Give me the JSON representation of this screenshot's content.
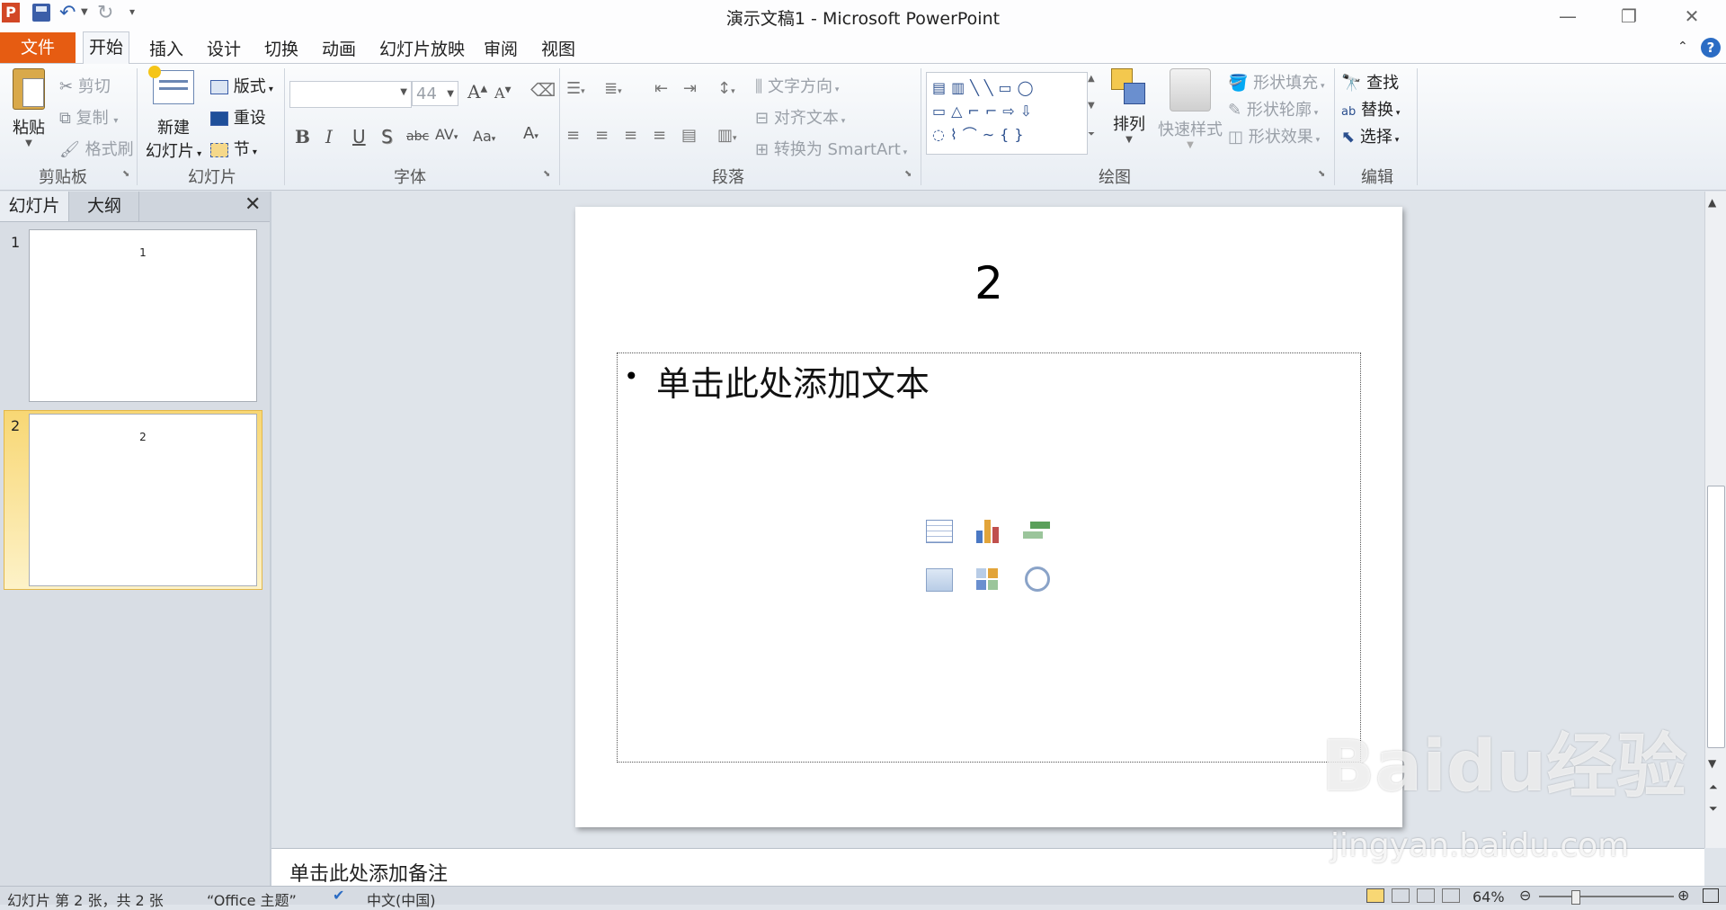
{
  "app": {
    "title": "演示文稿1 - Microsoft PowerPoint"
  },
  "quick_access": {
    "icons": [
      "powerpoint-logo-icon",
      "save-icon",
      "undo-icon",
      "redo-icon",
      "customize-icon"
    ]
  },
  "tabs": {
    "file": "文件",
    "items": [
      "开始",
      "插入",
      "设计",
      "切换",
      "动画",
      "幻灯片放映",
      "审阅",
      "视图"
    ],
    "active": "开始"
  },
  "ribbon": {
    "clipboard": {
      "paste": "粘贴",
      "cut": "剪切",
      "copy": "复制",
      "format_painter": "格式刷",
      "label": "剪贴板"
    },
    "slides": {
      "new_slide_1": "新建",
      "new_slide_2": "幻灯片",
      "layout": "版式",
      "reset": "重设",
      "section": "节",
      "label": "幻灯片"
    },
    "font": {
      "font_name": "",
      "font_size": "44",
      "label": "字体"
    },
    "paragraph": {
      "text_direction": "文字方向",
      "align_text": "对齐文本",
      "convert_smartart": "转换为 SmartArt",
      "label": "段落"
    },
    "drawing": {
      "arrange": "排列",
      "quick_styles": "快速样式",
      "shape_fill": "形状填充",
      "shape_outline": "形状轮廓",
      "shape_effects": "形状效果",
      "label": "绘图"
    },
    "editing": {
      "find": "查找",
      "replace": "替换",
      "select": "选择",
      "label": "编辑"
    }
  },
  "left_pane": {
    "tab_slides": "幻灯片",
    "tab_outline": "大纲",
    "slides": [
      {
        "number": "1",
        "title": "1"
      },
      {
        "number": "2",
        "title": "2"
      }
    ]
  },
  "slide": {
    "title": "2",
    "body_placeholder": "单击此处添加文本",
    "bullet": "•"
  },
  "notes": {
    "placeholder": "单击此处添加备注"
  },
  "status": {
    "slide_info": "幻灯片 第 2 张，共 2 张",
    "theme": "“Office 主题”",
    "language": "中文(中国)",
    "zoom": "64%"
  },
  "watermark": {
    "brand": "Baidu经验",
    "url": "jingyan.baidu.com"
  },
  "colors": {
    "file_tab": "#e65c12",
    "selected_thumb": "#f8d774"
  }
}
